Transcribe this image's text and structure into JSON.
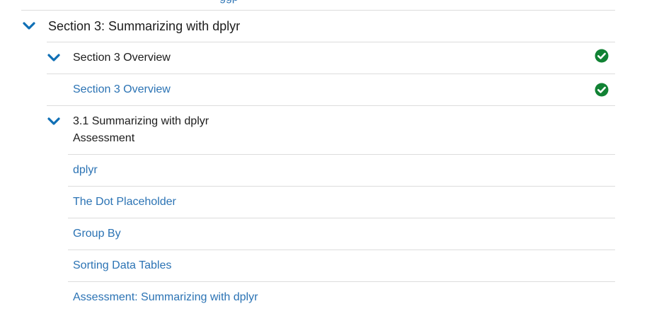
{
  "outline": {
    "partial_top_text": "ggp",
    "section": {
      "title": "Section 3: Summarizing with dplyr",
      "expanded": true
    },
    "subsections": [
      {
        "title": "Section 3 Overview",
        "expanded": true,
        "completed": true,
        "units": [
          {
            "label": "Section 3 Overview",
            "completed": true
          }
        ]
      },
      {
        "title_line1": "3.1 Summarizing with dplyr",
        "title_line2": "Assessment",
        "expanded": true,
        "units": [
          {
            "label": "dplyr"
          },
          {
            "label": "The Dot Placeholder"
          },
          {
            "label": "Group By"
          },
          {
            "label": "Sorting Data Tables"
          },
          {
            "label": "Assessment: Summarizing with dplyr"
          }
        ]
      }
    ]
  },
  "colors": {
    "chevron": "#0f6fb5",
    "link": "#2b73b4",
    "check": "#118234",
    "divider": "#dcdcdc"
  },
  "icons": {
    "expand": "chevron-down-icon",
    "complete": "check-circle-icon"
  }
}
